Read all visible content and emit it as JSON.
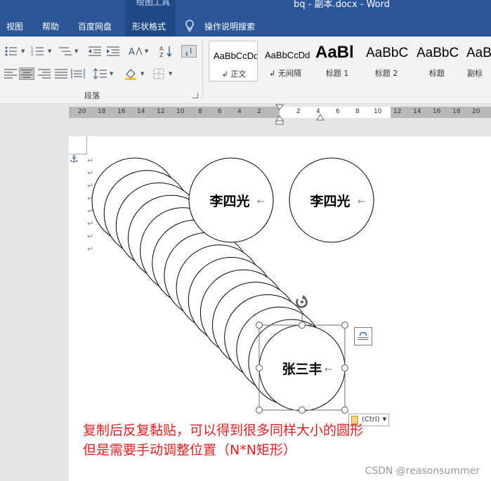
{
  "window": {
    "context_tab": "绘图工具",
    "title": "bq - 副本.docx  -  Word"
  },
  "menu": {
    "items": [
      "视图",
      "帮助",
      "百度网盘",
      "形状格式"
    ],
    "search": "操作说明搜索"
  },
  "ribbon": {
    "paragraph_group": "段落",
    "styles": [
      {
        "preview": "AaBbCcDd",
        "name": "↲ 正文"
      },
      {
        "preview": "AaBbCcDd",
        "name": "↲ 无间隔"
      },
      {
        "preview": "AaBl",
        "name": "标题 1"
      },
      {
        "preview": "AaBbC",
        "name": "标题 2"
      },
      {
        "preview": "AaBbC",
        "name": "标题"
      },
      {
        "preview": "AaBb",
        "name": "副标"
      }
    ]
  },
  "ruler": {
    "numbers": [
      "20",
      "18",
      "16",
      "14",
      "12",
      "10",
      "8",
      "6",
      "4",
      "2",
      "2",
      "4",
      "6",
      "8",
      "10",
      "12",
      "14",
      "16",
      "18",
      "20"
    ]
  },
  "document": {
    "para_mark": "↵",
    "circle_top_1": "李四光",
    "circle_top_2": "李四光",
    "circle_selected": "张三丰",
    "circle_mark": "←",
    "paste_label": "(Ctrl)",
    "annotation_line1": "复制后反复黏贴，可以得到很多同样大小的圆形",
    "annotation_line2": "但是需要手动调整位置（N*N矩形）"
  },
  "watermark": "CSDN @reasonsummer",
  "colors": {
    "title_bar": "#2b579a",
    "annotation": "#e02020",
    "anchor": "#2b579a"
  }
}
